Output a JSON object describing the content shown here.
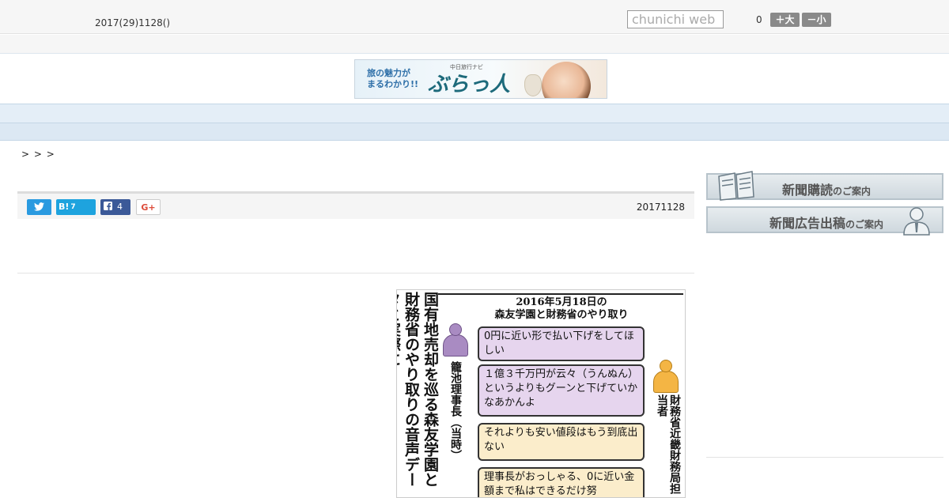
{
  "header": {
    "date": "2017(29)1128()",
    "search_placeholder": "chunichi web",
    "count": "0",
    "font_larger": "＋大",
    "font_smaller": "－小"
  },
  "banner": {
    "copy_line1": "旅の魅力が",
    "copy_line2": "まるわかり!!",
    "small": "中日旅行ナビ",
    "logo": "ぶらっ人"
  },
  "gnav": {
    "items": [
      "　",
      "　",
      "　",
      "　",
      "　",
      "　",
      "　",
      "　",
      "　"
    ]
  },
  "breadcrumb": "> > >",
  "share": {
    "hatena_label": "B!",
    "hatena_count": "7",
    "facebook_count": "4",
    "gplus_label": "G+",
    "date": "20171128"
  },
  "figure": {
    "title": "国有地売却を巡る森友学園と財務省のやり取りの音声データと実際に",
    "head_line1": "2016年5月18日の",
    "head_line2": "森友学園と財務省のやり取り",
    "speaker_left": "籠池理事長（当時）",
    "speaker_right_1": "財務省近畿財務局",
    "speaker_right_2": "担当者",
    "bubbles": [
      "0円に近い形で払い下げをしてほしい",
      "１億３千万円が云々（うんぬん）というよりもグーンと下げていかなあかんよ",
      "それよりも安い値段はもう到底出ない",
      "理事長がおっしゃる、0に近い金額まで私はできるだけ努"
    ]
  },
  "sidebar": {
    "subscribe_main": "新聞購読",
    "subscribe_sub": "のご案内",
    "ad_main": "新聞広告出稿",
    "ad_sub": "のご案内"
  },
  "colors": {
    "nav_bg": "#e4eef7",
    "twitter": "#2a9ae0",
    "hatena": "#1ea3de",
    "facebook": "#3b5998"
  }
}
